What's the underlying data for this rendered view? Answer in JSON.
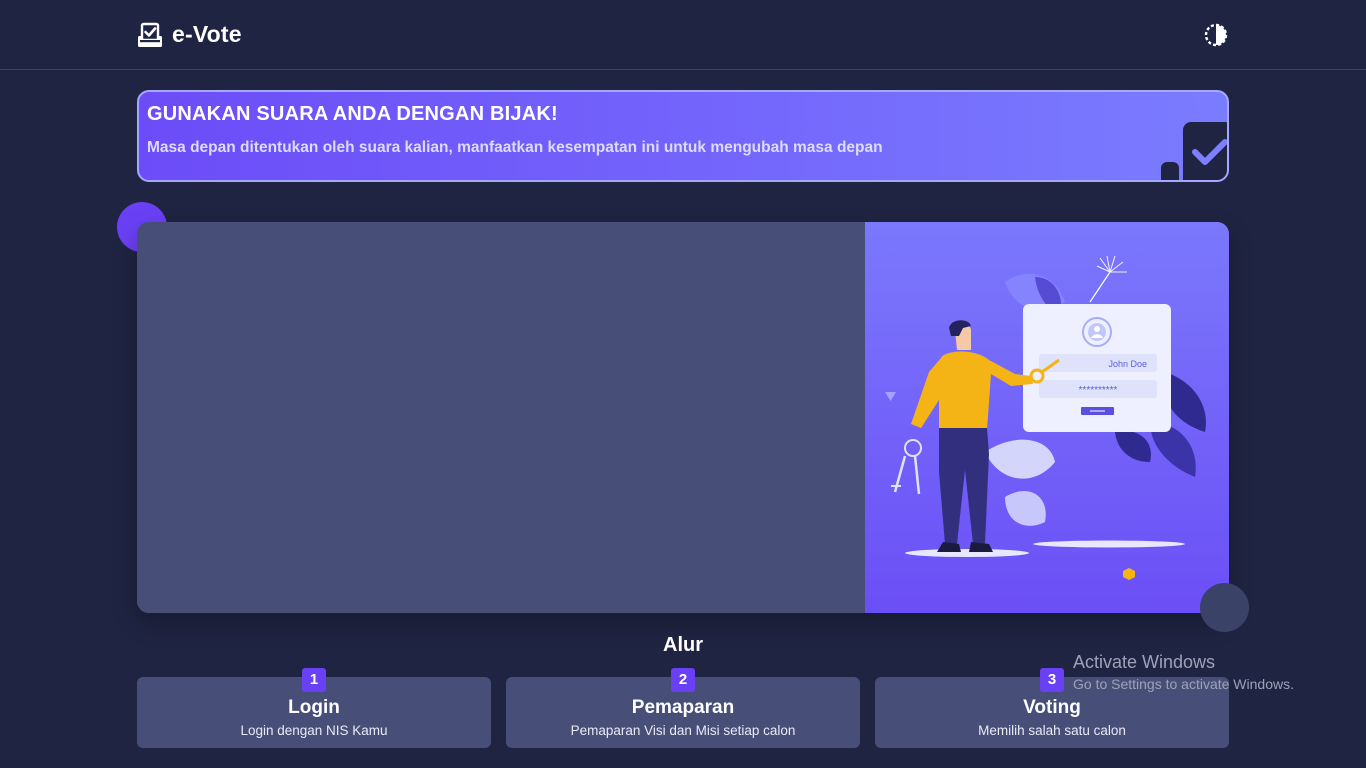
{
  "header": {
    "brand": "e-Vote",
    "brand_icon": "ballot-box-icon",
    "theme_icon": "contrast-toggle-icon"
  },
  "banner": {
    "title": "GUNAKAN SUARA ANDA DENGAN BIJAK!",
    "subtitle": "Masa depan ditentukan oleh suara kalian, manfaatkan kesempatan ini untuk mengubah masa depan",
    "icon": "checkbox-check-icon"
  },
  "hero": {
    "illustration": "person-with-key-login-illustration",
    "login_card": {
      "username": "John Doe",
      "password": "**********"
    }
  },
  "flow": {
    "title": "Alur",
    "steps": [
      {
        "number": "1",
        "title": "Login",
        "description": "Login dengan NIS Kamu"
      },
      {
        "number": "2",
        "title": "Pemaparan",
        "description": "Pemaparan Visi dan Misi setiap calon"
      },
      {
        "number": "3",
        "title": "Voting",
        "description": "Memilih salah satu calon"
      }
    ]
  },
  "watermark": {
    "title": "Activate Windows",
    "subtitle": "Go to Settings to activate Windows."
  },
  "colors": {
    "background": "#1f2442",
    "accent": "#6a40f5",
    "card": "#474f78"
  }
}
